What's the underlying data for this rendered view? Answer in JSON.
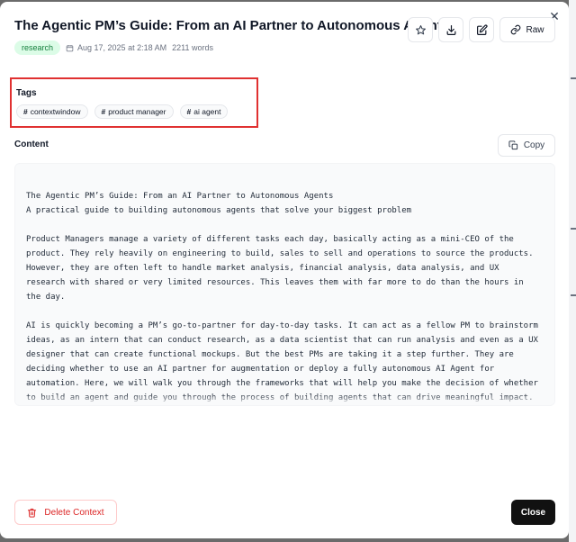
{
  "modal": {
    "title": "The Agentic PM’s Guide: From an AI Partner to Autonomous Agents",
    "category_badge": "research",
    "date": "Aug 17, 2025 at 2:18 AM",
    "word_count": "2211 words",
    "raw_label": "Raw"
  },
  "tags": {
    "label": "Tags",
    "items": [
      "contextwindow",
      "product manager",
      "ai agent"
    ]
  },
  "content": {
    "label": "Content",
    "copy_label": "Copy",
    "lines": [
      "The Agentic PM’s Guide: From an AI Partner to Autonomous Agents",
      "A practical guide to building autonomous agents that solve your biggest problem",
      "",
      "Product Managers manage a variety of different tasks each day, basically acting as a mini-CEO of the",
      "product. They rely heavily on engineering to build, sales to sell and operations to source the products.",
      "However, they are often left to handle market analysis, financial analysis, data analysis, and UX",
      "research with shared or very limited resources. This leaves them with far more to do than the hours in",
      "the day.",
      "",
      "AI is quickly becoming a PM’s go-to-partner for day-to-day tasks. It can act as a fellow PM to brainstorm",
      "ideas, as an intern that can conduct research, as a data scientist that can run analysis and even as a UX",
      "designer that can create functional mockups. But the best PMs are taking it a step further. They are",
      "deciding whether to use an AI partner for augmentation or deploy a fully autonomous AI Agent for",
      "automation. Here, we will walk you through the frameworks that will help you make the decision of whether",
      "to build an agent and guide you through the process of building agents that can drive meaningful impact."
    ]
  },
  "footer": {
    "delete_label": "Delete Context",
    "close_label": "Close"
  },
  "icons": {
    "star": "star-icon",
    "download": "download-icon",
    "edit": "edit-icon",
    "link": "link-icon",
    "calendar": "calendar-icon",
    "copy": "copy-icon",
    "trash": "trash-icon",
    "close": "close-icon"
  },
  "colors": {
    "badge_bg": "#dcfce7",
    "badge_text": "#15803d",
    "highlight_border": "#e03131",
    "delete_text": "#dc2626",
    "primary_button": "#111111"
  }
}
